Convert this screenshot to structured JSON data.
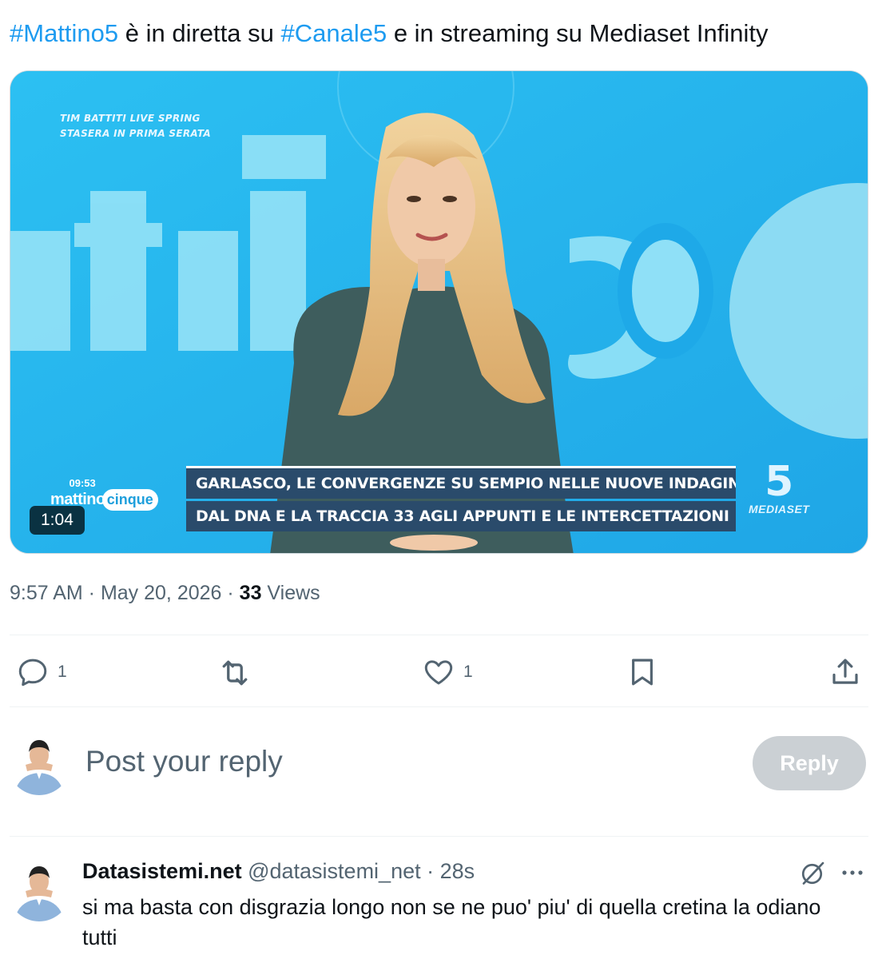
{
  "tweet": {
    "hashtag1": "#Mattino5",
    "text1": " è in diretta su ",
    "hashtag2": "#Canale5",
    "text2": " e in streaming su Mediaset Infinity"
  },
  "video": {
    "promo_line1": "TIM BATTITI LIVE SPRING",
    "promo_line2": "STASERA IN PRIMA SERATA",
    "clock": "09:53",
    "logo_brand": "mattino",
    "logo_cinque": "cinque",
    "ticker_line1": "GARLASCO, LE CONVERGENZE SU SEMPIO NELLE NUOVE INDAGINI",
    "ticker_line2": "DAL DNA E LA TRACCIA 33 AGLI APPUNTI E LE INTERCETTAZIONI",
    "channel_number": "5",
    "channel_label": "MEDIASET",
    "duration": "1:04",
    "colors": {
      "studio": "#27b6ee",
      "ticker": "#2a4b6b",
      "dress": "#3e5d5d",
      "hair": "#e9c48a"
    }
  },
  "meta": {
    "time": "9:57 AM",
    "sep1": " · ",
    "date": "May 20, 2026",
    "sep2": " · ",
    "views_count": "33",
    "views_label": " Views"
  },
  "actions": {
    "reply_icon": "reply-icon",
    "reply_count": "1",
    "retweet_icon": "retweet-icon",
    "like_icon": "heart-icon",
    "like_count": "1",
    "bookmark_icon": "bookmark-icon",
    "share_icon": "share-icon"
  },
  "composer": {
    "placeholder": "Post your reply",
    "button_label": "Reply"
  },
  "reply": {
    "name": "Datasistemi.net",
    "handle": "@datasistemi_net",
    "separator": " · ",
    "age": "28s",
    "text": "si ma basta con disgrazia longo non se ne puo' piu' di quella cretina la odiano tutti"
  },
  "colors": {
    "link": "#1d9bf0",
    "text": "#0f1419",
    "secondary": "#536471",
    "divider": "#eff3f4",
    "reply_button_disabled": "#cbd0d4"
  }
}
